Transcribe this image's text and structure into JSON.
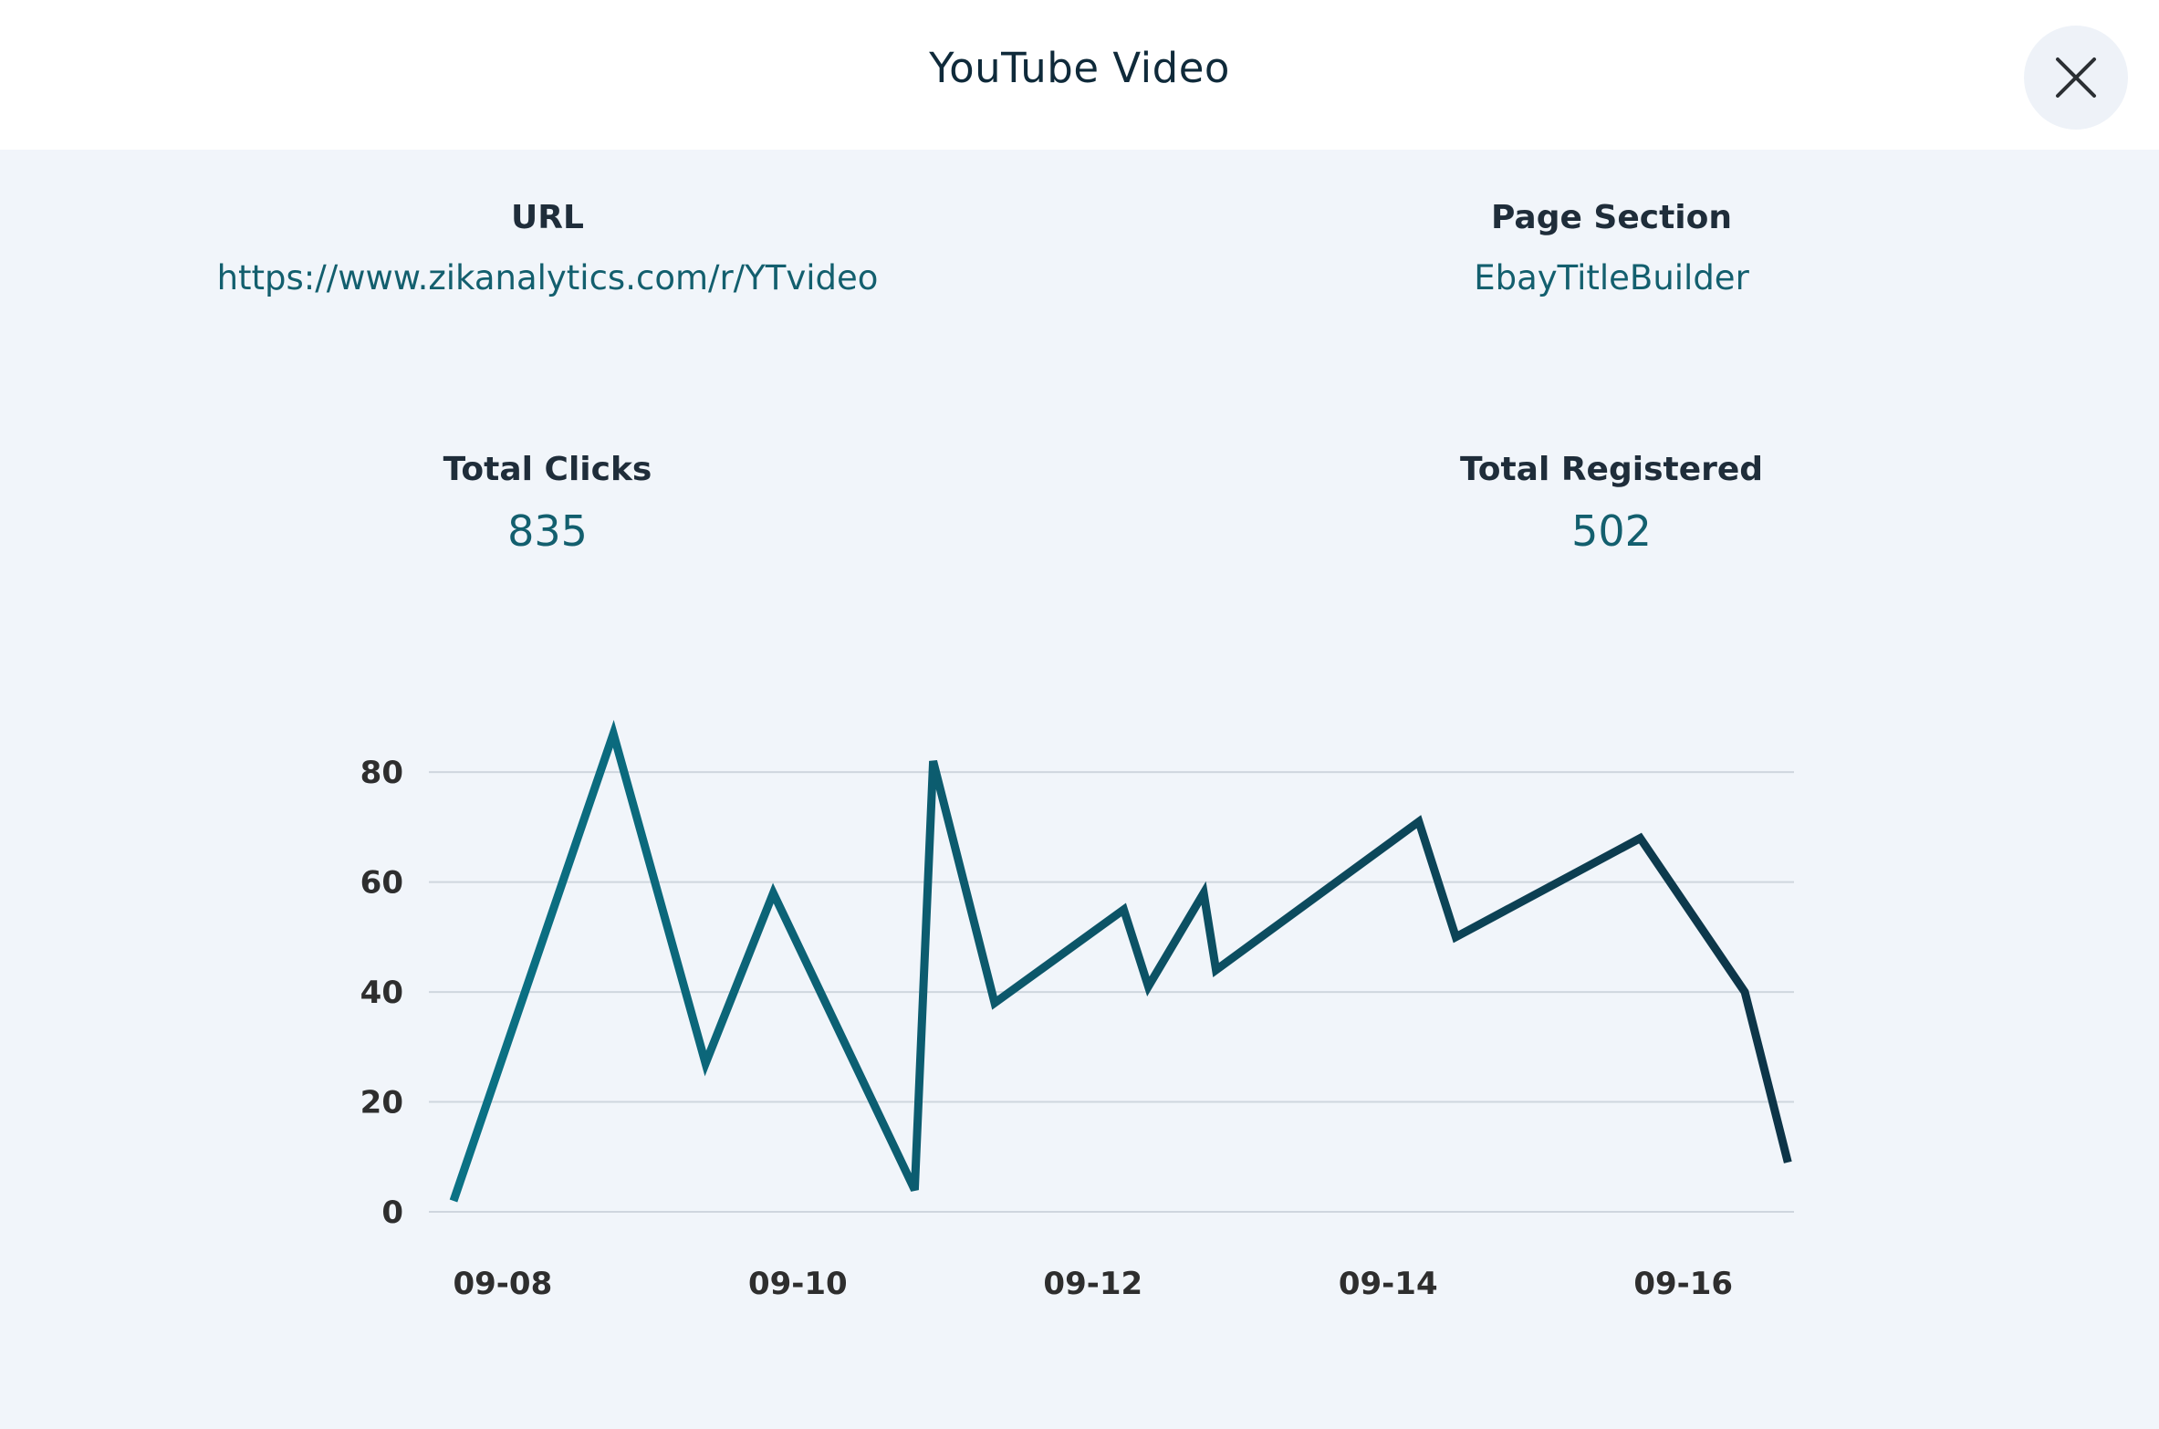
{
  "modal": {
    "title": "YouTube Video",
    "close_icon": "close-icon"
  },
  "info": {
    "url_label": "URL",
    "url_value": "https://www.zikanalytics.com/r/YTvideo",
    "section_label": "Page Section",
    "section_value": "EbayTitleBuilder",
    "clicks_label": "Total Clicks",
    "clicks_value": "835",
    "registered_label": "Total Registered",
    "registered_value": "502"
  },
  "colors": {
    "line_start": "#0b7285",
    "line_end": "#0d3447",
    "grid": "#cfd6de",
    "accent_text": "#135f6e"
  },
  "chart_data": {
    "type": "line",
    "x_ticks": [
      "09-08",
      "09-10",
      "09-12",
      "09-14",
      "09-16"
    ],
    "y_ticks": [
      0,
      20,
      40,
      60,
      80
    ],
    "ylim": [
      0,
      88
    ],
    "xlim": [
      "09-07 12:00",
      "09-16 18:00"
    ],
    "grid": true,
    "series": [
      {
        "points": [
          {
            "x": "09-07 16:00",
            "y": 2
          },
          {
            "x": "09-08 18:00",
            "y": 87
          },
          {
            "x": "09-09 09:00",
            "y": 27
          },
          {
            "x": "09-09 20:00",
            "y": 58
          },
          {
            "x": "09-10 19:00",
            "y": 4
          },
          {
            "x": "09-10 22:00",
            "y": 82
          },
          {
            "x": "09-11 08:00",
            "y": 38
          },
          {
            "x": "09-12 05:00",
            "y": 55
          },
          {
            "x": "09-12 09:00",
            "y": 41
          },
          {
            "x": "09-12 18:00",
            "y": 58
          },
          {
            "x": "09-12 20:00",
            "y": 44
          },
          {
            "x": "09-14 05:00",
            "y": 71
          },
          {
            "x": "09-14 11:00",
            "y": 50
          },
          {
            "x": "09-15 17:00",
            "y": 68
          },
          {
            "x": "09-16 10:00",
            "y": 40
          },
          {
            "x": "09-16 17:00",
            "y": 9
          }
        ]
      }
    ]
  }
}
